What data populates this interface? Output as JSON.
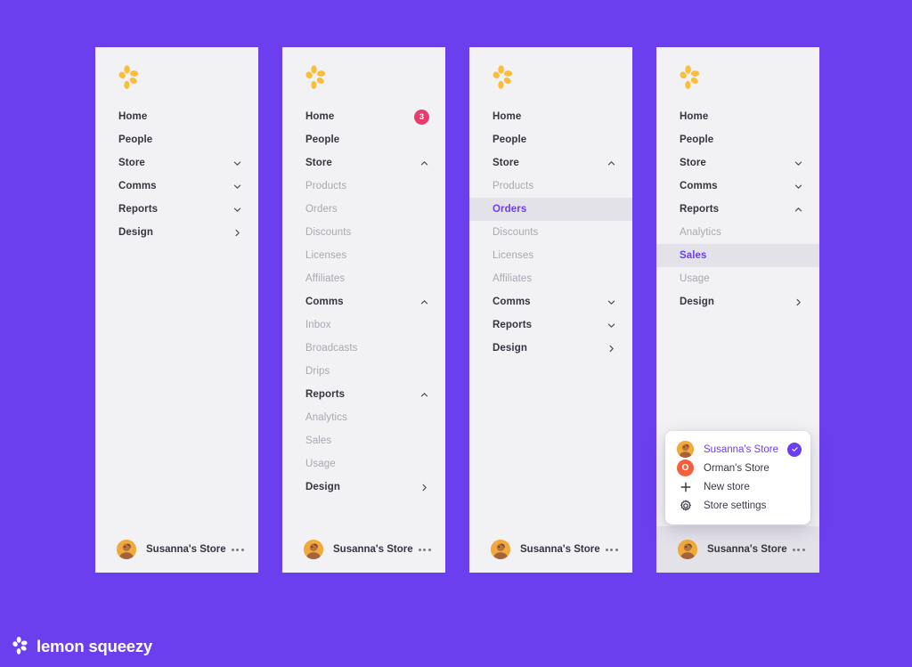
{
  "brand": {
    "name": "lemon squeezy",
    "logo_icon": "lemon-squeezy-mark",
    "background_color": "#6B3FEE"
  },
  "colors": {
    "panel_bg": "#F2F2F4",
    "accent": "#6B3FEE",
    "active_row_bg": "#E4E2E9",
    "top_label": "#36343F",
    "sub_label": "#A9A7B2",
    "badge": "#EB3B6E",
    "popup_bg": "#FFFFFF",
    "orman_avatar": "#F4603E"
  },
  "store_footer": {
    "name": "Susanna's Store",
    "avatar_icon": "user-avatar",
    "more_icon": "more-horizontal-icon"
  },
  "panels": [
    {
      "id": "panel-collapsed",
      "logo_icon": "lemon-squeezy-mark",
      "items": [
        {
          "label": "Home",
          "level": "top",
          "trailing": "none"
        },
        {
          "label": "People",
          "level": "top",
          "trailing": "none"
        },
        {
          "label": "Store",
          "level": "top",
          "trailing": "chevron-down-icon"
        },
        {
          "label": "Comms",
          "level": "top",
          "trailing": "chevron-down-icon"
        },
        {
          "label": "Reports",
          "level": "top",
          "trailing": "chevron-down-icon"
        },
        {
          "label": "Design",
          "level": "top",
          "trailing": "chevron-right-icon"
        }
      ],
      "footer_highlight": false
    },
    {
      "id": "panel-expanded-all",
      "logo_icon": "lemon-squeezy-mark",
      "items": [
        {
          "label": "Home",
          "level": "top",
          "trailing": "badge",
          "badge": "3"
        },
        {
          "label": "People",
          "level": "top",
          "trailing": "none"
        },
        {
          "label": "Store",
          "level": "top",
          "trailing": "chevron-up-icon"
        },
        {
          "label": "Products",
          "level": "sub",
          "trailing": "none"
        },
        {
          "label": "Orders",
          "level": "sub",
          "trailing": "none"
        },
        {
          "label": "Discounts",
          "level": "sub",
          "trailing": "none"
        },
        {
          "label": "Licenses",
          "level": "sub",
          "trailing": "none"
        },
        {
          "label": "Affiliates",
          "level": "sub",
          "trailing": "none"
        },
        {
          "label": "Comms",
          "level": "top",
          "trailing": "chevron-up-icon"
        },
        {
          "label": "Inbox",
          "level": "sub",
          "trailing": "none"
        },
        {
          "label": "Broadcasts",
          "level": "sub",
          "trailing": "none"
        },
        {
          "label": "Drips",
          "level": "sub",
          "trailing": "none"
        },
        {
          "label": "Reports",
          "level": "top",
          "trailing": "chevron-up-icon"
        },
        {
          "label": "Analytics",
          "level": "sub",
          "trailing": "none"
        },
        {
          "label": "Sales",
          "level": "sub",
          "trailing": "none"
        },
        {
          "label": "Usage",
          "level": "sub",
          "trailing": "none"
        },
        {
          "label": "Design",
          "level": "top",
          "trailing": "chevron-right-icon"
        }
      ],
      "footer_highlight": false
    },
    {
      "id": "panel-store-expanded",
      "logo_icon": "lemon-squeezy-mark",
      "items": [
        {
          "label": "Home",
          "level": "top",
          "trailing": "none"
        },
        {
          "label": "People",
          "level": "top",
          "trailing": "none"
        },
        {
          "label": "Store",
          "level": "top",
          "trailing": "chevron-up-icon"
        },
        {
          "label": "Products",
          "level": "sub",
          "trailing": "none"
        },
        {
          "label": "Orders",
          "level": "sub",
          "trailing": "none",
          "active": true
        },
        {
          "label": "Discounts",
          "level": "sub",
          "trailing": "none"
        },
        {
          "label": "Licenses",
          "level": "sub",
          "trailing": "none"
        },
        {
          "label": "Affiliates",
          "level": "sub",
          "trailing": "none"
        },
        {
          "label": "Comms",
          "level": "top",
          "trailing": "chevron-down-icon"
        },
        {
          "label": "Reports",
          "level": "top",
          "trailing": "chevron-down-icon"
        },
        {
          "label": "Design",
          "level": "top",
          "trailing": "chevron-right-icon"
        }
      ],
      "footer_highlight": false
    },
    {
      "id": "panel-reports-expanded",
      "logo_icon": "lemon-squeezy-mark",
      "items": [
        {
          "label": "Home",
          "level": "top",
          "trailing": "none"
        },
        {
          "label": "People",
          "level": "top",
          "trailing": "none"
        },
        {
          "label": "Store",
          "level": "top",
          "trailing": "chevron-down-icon"
        },
        {
          "label": "Comms",
          "level": "top",
          "trailing": "chevron-down-icon"
        },
        {
          "label": "Reports",
          "level": "top",
          "trailing": "chevron-up-icon"
        },
        {
          "label": "Analytics",
          "level": "sub",
          "trailing": "none"
        },
        {
          "label": "Sales",
          "level": "sub",
          "trailing": "none",
          "active": true
        },
        {
          "label": "Usage",
          "level": "sub",
          "trailing": "none"
        },
        {
          "label": "Design",
          "level": "top",
          "trailing": "chevron-right-icon"
        }
      ],
      "footer_highlight": true
    }
  ],
  "store_popup": {
    "items": [
      {
        "label": "Susanna's Store",
        "icon": "user-avatar",
        "selected": true,
        "check_icon": "check-icon"
      },
      {
        "label": "Orman's Store",
        "icon": "letter-avatar-o",
        "letter": "O",
        "selected": false
      },
      {
        "label": "New store",
        "icon": "plus-icon",
        "selected": false
      },
      {
        "label": "Store settings",
        "icon": "gear-icon",
        "selected": false
      }
    ]
  }
}
